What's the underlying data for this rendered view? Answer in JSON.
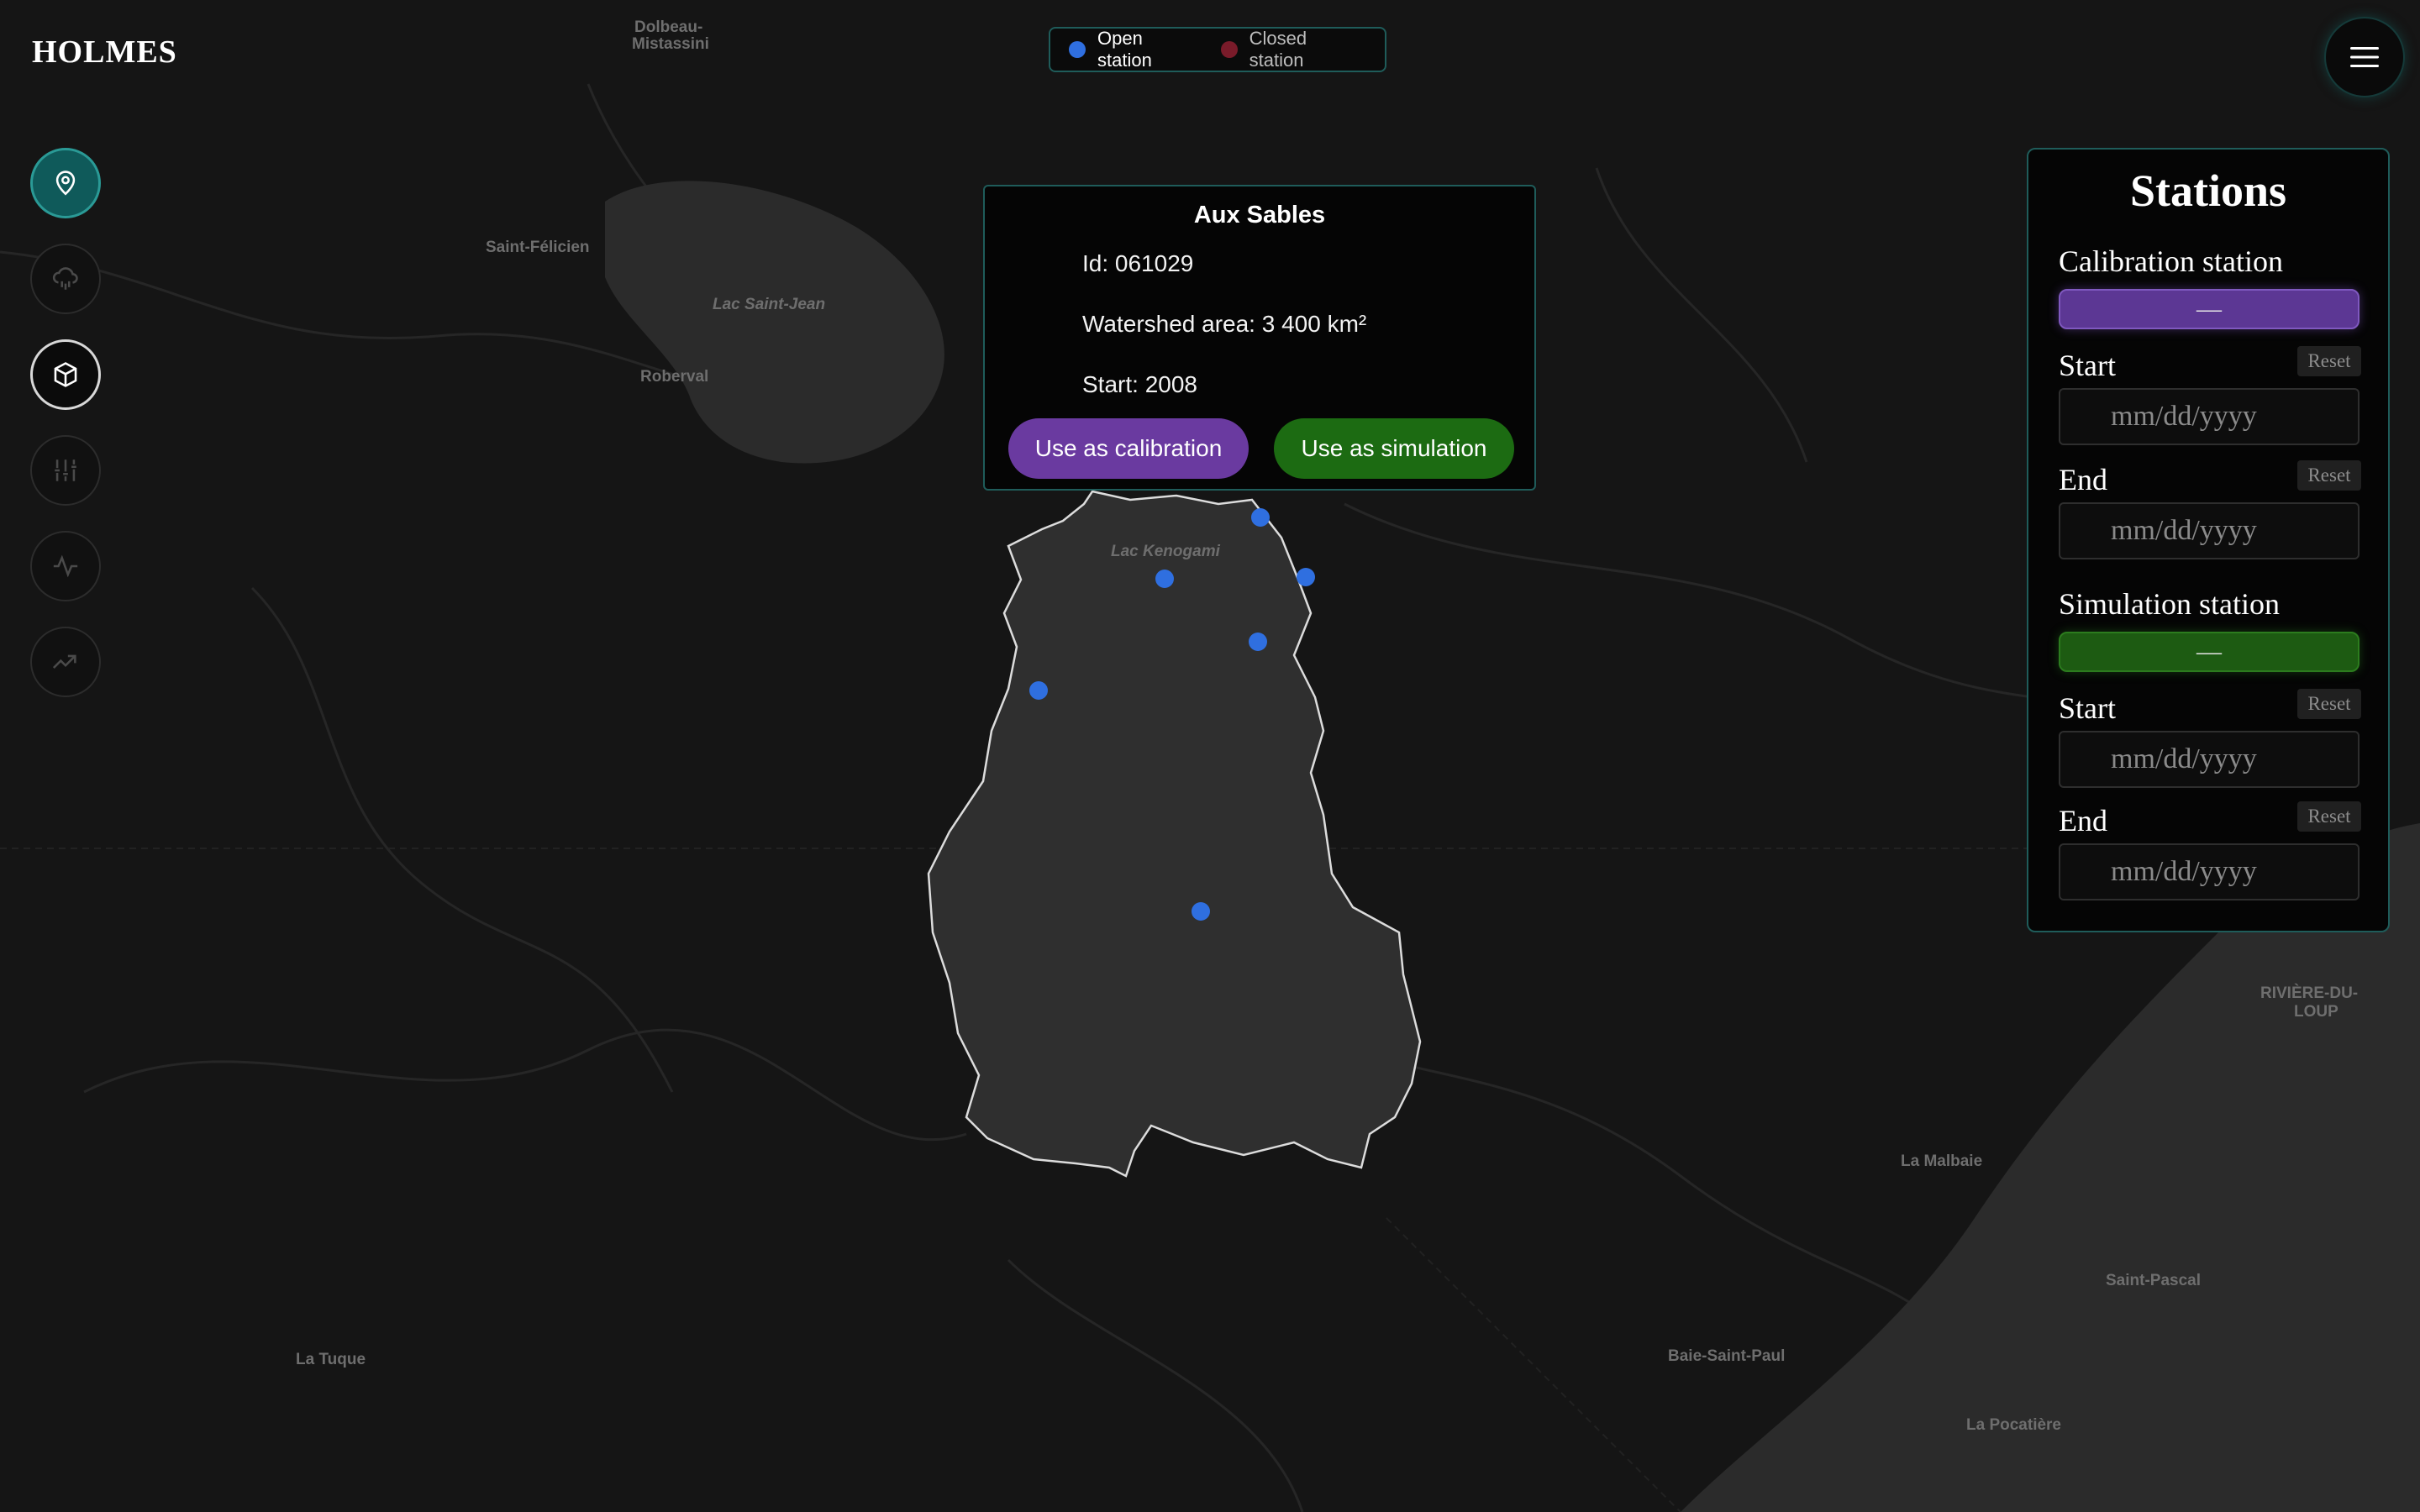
{
  "app": {
    "title": "HOLMES"
  },
  "legend": {
    "open_label": "Open station",
    "closed_label": "Closed station",
    "open_color": "#2f6fe0",
    "closed_color": "#7a1b2a"
  },
  "sidebar": {
    "items": [
      {
        "name": "location-icon",
        "state": "active"
      },
      {
        "name": "rain-cloud-icon",
        "state": "inactive"
      },
      {
        "name": "cube-icon",
        "state": "selected"
      },
      {
        "name": "sliders-icon",
        "state": "inactive"
      },
      {
        "name": "activity-icon",
        "state": "inactive"
      },
      {
        "name": "trending-up-icon",
        "state": "inactive"
      }
    ]
  },
  "popup": {
    "title": "Aux Sables",
    "id_text": "Id: 061029",
    "area_text": "Watershed area: 3 400 km²",
    "start_text": "Start: 2008",
    "calibration_button": "Use as calibration",
    "simulation_button": "Use as simulation"
  },
  "panel": {
    "title": "Stations",
    "calibration": {
      "label": "Calibration station",
      "value": "—",
      "start_label": "Start",
      "end_label": "End",
      "reset_label": "Reset",
      "date_placeholder": "mm/dd/yyyy"
    },
    "simulation": {
      "label": "Simulation station",
      "value": "—",
      "start_label": "Start",
      "end_label": "End",
      "reset_label": "Reset",
      "date_placeholder": "mm/dd/yyyy"
    }
  },
  "map": {
    "place_labels": [
      "Dolbeau-",
      "Mistassini",
      "Saint-Félicien",
      "Lac Saint-Jean",
      "Roberval",
      "Lac Kenogami",
      "RIVIÈRE-DU-",
      "LOUP",
      "La Malbaie",
      "Saint-Pascal",
      "Baie-Saint-Paul",
      "La Tuque",
      "La Pocatière"
    ],
    "station_count": 6
  },
  "colors": {
    "accent": "#1f5c5a",
    "calibration": "#6a3aa0",
    "simulation": "#1c6b12"
  }
}
